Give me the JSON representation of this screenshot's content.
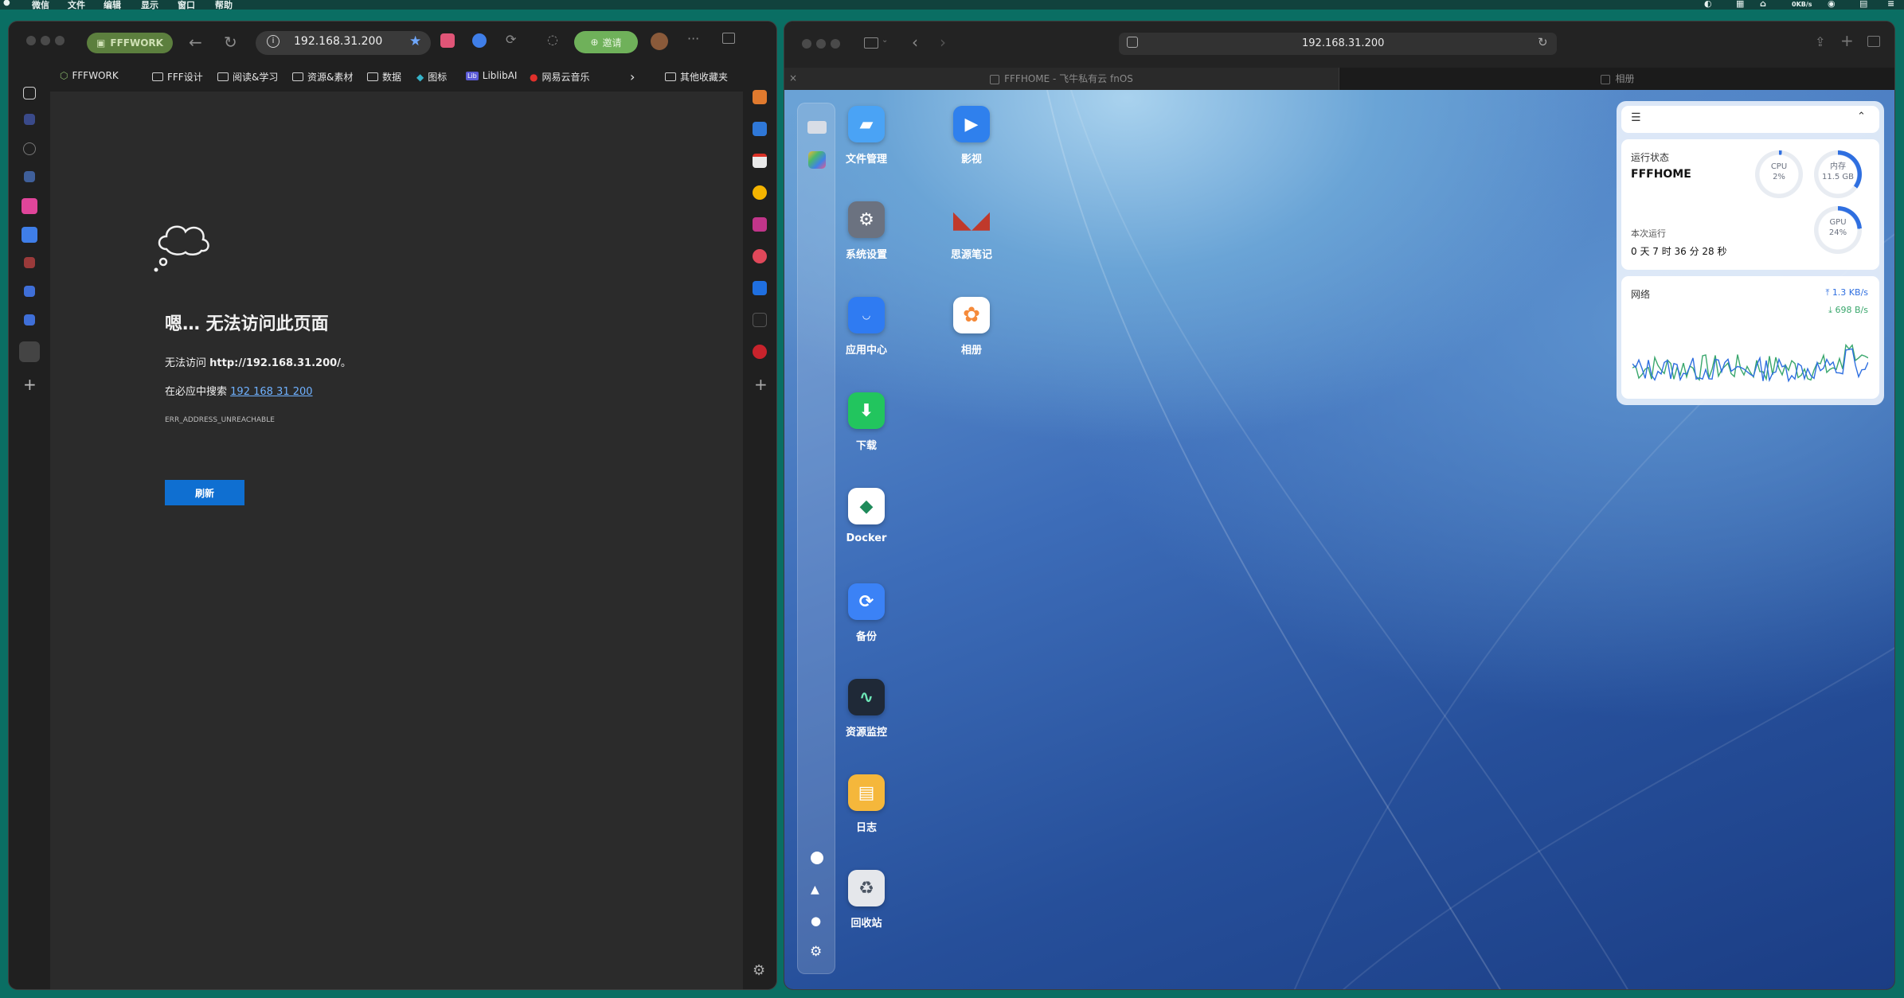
{
  "menubar": {
    "items": [
      "微信",
      "文件",
      "编辑",
      "显示",
      "窗口",
      "帮助"
    ],
    "net_speed": "0KB/s"
  },
  "edge": {
    "profile_badge": "FFFWORK",
    "address": "192.168.31.200",
    "invite_label": "邀请",
    "favorites": [
      "FFFWORK",
      "FFF设计",
      "阅读&学习",
      "资源&素材",
      "数据",
      "图标",
      "LiblibAI",
      "网易云音乐"
    ],
    "other_favorites": "其他收藏夹",
    "error": {
      "title": "嗯… 无法访问此页面",
      "line1_prefix": "无法访问",
      "line1_url": "http://192.168.31.200/",
      "line1_suffix": "。",
      "line2_prefix": "在必应中搜索",
      "line2_link": "192 168 31 200",
      "code": "ERR_ADDRESS_UNREACHABLE",
      "refresh_label": "刷新"
    }
  },
  "safari": {
    "address": "192.168.31.200",
    "tabs": [
      {
        "title": "FFFHOME - 飞牛私有云 fnOS",
        "active": true
      },
      {
        "title": "相册",
        "active": false
      }
    ],
    "apps": [
      {
        "label": "文件管理",
        "icon": "folder-icon",
        "color": "#4aa3f5"
      },
      {
        "label": "影视",
        "icon": "video-icon",
        "color": "#2f80ed"
      },
      {
        "label": "系统设置",
        "icon": "settings-icon",
        "color": "#6b7280"
      },
      {
        "label": "思源笔记",
        "icon": "siyuan-notes-icon",
        "color": "#c0392b"
      },
      {
        "label": "应用中心",
        "icon": "store-icon",
        "color": "#2f7bf2"
      },
      {
        "label": "相册",
        "icon": "photos-icon",
        "color": "#ffffff"
      },
      {
        "label": "下载",
        "icon": "download-icon",
        "color": "#22c55e"
      },
      {
        "label": "Docker",
        "icon": "docker-icon",
        "color": "#ffffff"
      },
      {
        "label": "备份",
        "icon": "backup-icon",
        "color": "#3b82f6"
      },
      {
        "label": "资源监控",
        "icon": "resource-monitor-icon",
        "color": "#1f2937"
      },
      {
        "label": "日志",
        "icon": "log-icon",
        "color": "#f5b73b"
      },
      {
        "label": "回收站",
        "icon": "recycle-bin-icon",
        "color": "#e5e7eb"
      }
    ],
    "widget": {
      "status_title": "运行状态",
      "host_name": "FFFHOME",
      "cpu_label": "CPU",
      "cpu_value": "2%",
      "cpu_fraction": 0.02,
      "mem_label": "内存",
      "mem_value": "11.5 GB",
      "mem_fraction": 0.35,
      "gpu_label": "GPU",
      "gpu_value": "24%",
      "gpu_fraction": 0.24,
      "uptime_label": "本次运行",
      "uptime_value": "0 天 7 时 36 分 28 秒",
      "network_title": "网络",
      "upload": "1.3 KB/s",
      "download": "698 B/s",
      "colors": {
        "upload": "#2f6fe0",
        "download": "#3aa76d"
      }
    }
  }
}
